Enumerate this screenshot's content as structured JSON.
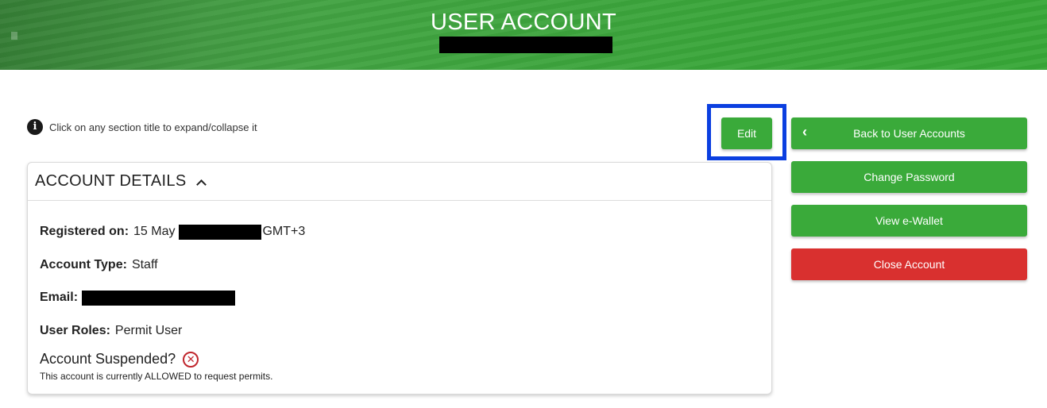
{
  "banner": {
    "title": "USER ACCOUNT",
    "bg_color": "#3aa63a"
  },
  "hint": {
    "icon": "info-icon",
    "text": "Click on any section title to expand/collapse it"
  },
  "actions": {
    "edit_label": "Edit",
    "back_label": "Back to User Accounts",
    "change_password_label": "Change Password",
    "view_wallet_label": "View e-Wallet",
    "close_account_label": "Close Account",
    "primary_color": "#3aaa3a",
    "danger_color": "#d9302f",
    "highlight_color": "#0b3fe0"
  },
  "account_details": {
    "section_title": "ACCOUNT DETAILS",
    "expanded": true,
    "registered_label": "Registered on:",
    "registered_prefix": "15 May",
    "registered_suffix": "GMT+3",
    "account_type_label": "Account Type:",
    "account_type_value": "Staff",
    "email_label": "Email:",
    "user_roles_label": "User Roles:",
    "user_roles_value": "Permit User",
    "suspended_label": "Account Suspended?",
    "suspended_icon": "x-circle-icon",
    "suspended_note": "This account is currently ALLOWED to request permits."
  }
}
